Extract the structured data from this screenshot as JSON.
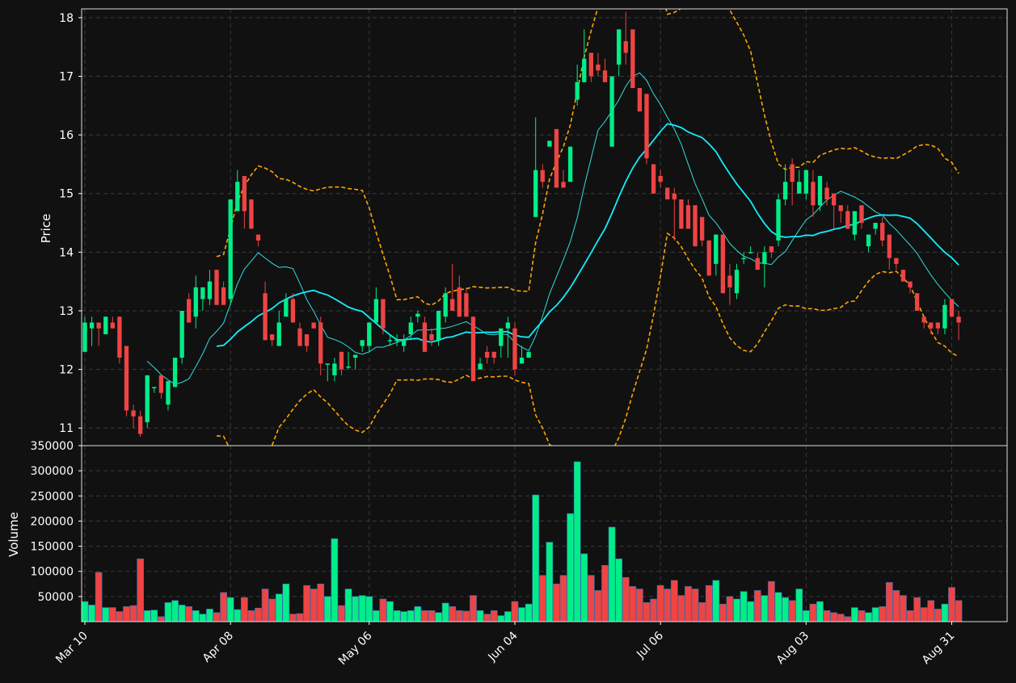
{
  "chart_data": {
    "type": "candlestick",
    "panels": [
      "price",
      "volume"
    ],
    "ylabel": "Price",
    "volume_ylabel": "Volume",
    "ylim": [
      10.7,
      18.15
    ],
    "volume_ylim": [
      0,
      350000
    ],
    "yticks": [
      11,
      12,
      13,
      14,
      15,
      16,
      17,
      18
    ],
    "volume_yticks": [
      50000,
      100000,
      150000,
      200000,
      250000,
      300000,
      350000
    ],
    "xticks": [
      {
        "label": "Mar 10",
        "index": 0
      },
      {
        "label": "Apr 08",
        "index": 21
      },
      {
        "label": "May 06",
        "index": 41
      },
      {
        "label": "Jun 04",
        "index": 62
      },
      {
        "label": "Jul 06",
        "index": 83
      },
      {
        "label": "Aug 03",
        "index": 104
      },
      {
        "label": "Aug 31",
        "index": 125
      }
    ],
    "grid": true,
    "colors": {
      "background": "#111111",
      "up": "#00ee88",
      "down": "#ee4444",
      "edge": "#3a6fb0",
      "ma_fast": "#33dddd",
      "ma_slow": "#11eeff",
      "bands": "#ffa500",
      "grid": "#3a3a3a",
      "text": "#ffffff"
    },
    "candles": [
      [
        12.3,
        12.9,
        12.3,
        12.8,
        40000
      ],
      [
        12.7,
        12.9,
        12.4,
        12.8,
        33000
      ],
      [
        12.8,
        12.8,
        12.4,
        12.7,
        98000
      ],
      [
        12.6,
        12.9,
        12.6,
        12.9,
        28000
      ],
      [
        12.8,
        12.9,
        12.7,
        12.7,
        28000
      ],
      [
        12.9,
        12.9,
        12.1,
        12.2,
        20000
      ],
      [
        12.4,
        12.4,
        11.2,
        11.3,
        30000
      ],
      [
        11.3,
        11.4,
        11.0,
        11.2,
        32000
      ],
      [
        11.2,
        11.3,
        10.85,
        10.9,
        125000
      ],
      [
        11.1,
        11.9,
        11.0,
        11.9,
        22000
      ],
      [
        11.7,
        11.7,
        11.6,
        11.7,
        23000
      ],
      [
        11.9,
        11.9,
        11.5,
        11.6,
        10000
      ],
      [
        11.4,
        11.7,
        11.3,
        11.8,
        38000
      ],
      [
        11.7,
        12.2,
        11.7,
        12.2,
        42000
      ],
      [
        12.2,
        13.0,
        12.1,
        13.0,
        33000
      ],
      [
        13.2,
        13.3,
        12.9,
        12.8,
        30000
      ],
      [
        12.9,
        13.6,
        12.7,
        13.4,
        22000
      ],
      [
        13.2,
        13.4,
        13.0,
        13.4,
        15000
      ],
      [
        13.2,
        13.7,
        13.1,
        13.5,
        25000
      ],
      [
        13.7,
        13.7,
        13.3,
        13.1,
        18000
      ],
      [
        13.4,
        13.5,
        13.2,
        13.1,
        58000
      ],
      [
        13.2,
        14.9,
        13.1,
        14.9,
        48000
      ],
      [
        14.7,
        15.4,
        14.7,
        15.2,
        24000
      ],
      [
        15.3,
        15.3,
        14.4,
        14.7,
        48000
      ],
      [
        14.9,
        14.9,
        14.4,
        14.4,
        22000
      ],
      [
        14.3,
        14.3,
        14.1,
        14.2,
        27000
      ],
      [
        13.3,
        13.5,
        12.5,
        12.5,
        65000
      ],
      [
        12.6,
        12.6,
        12.4,
        12.5,
        45000
      ],
      [
        12.4,
        13.0,
        12.4,
        12.8,
        55000
      ],
      [
        12.9,
        13.3,
        12.9,
        13.2,
        75000
      ],
      [
        13.2,
        13.3,
        12.8,
        12.8,
        15000
      ],
      [
        12.7,
        12.8,
        12.4,
        12.4,
        16000
      ],
      [
        12.6,
        12.6,
        12.3,
        12.4,
        72000
      ],
      [
        12.8,
        12.8,
        12.7,
        12.7,
        65000
      ],
      [
        12.8,
        12.9,
        11.9,
        12.1,
        75000
      ],
      [
        12.1,
        12.1,
        11.8,
        12.1,
        50000
      ],
      [
        11.9,
        12.2,
        11.8,
        12.1,
        165000
      ],
      [
        12.3,
        12.3,
        11.9,
        12.0,
        32000
      ],
      [
        12.05,
        12.3,
        12.0,
        12.05,
        65000
      ],
      [
        12.2,
        12.2,
        12.0,
        12.25,
        50000
      ],
      [
        12.4,
        12.4,
        12.3,
        12.5,
        52000
      ],
      [
        12.4,
        12.8,
        12.3,
        12.8,
        50000
      ],
      [
        12.8,
        13.4,
        12.8,
        13.2,
        22000
      ],
      [
        13.2,
        13.2,
        12.6,
        12.7,
        45000
      ],
      [
        12.5,
        12.6,
        12.4,
        12.5,
        40000
      ],
      [
        12.5,
        12.6,
        12.4,
        12.5,
        22000
      ],
      [
        12.4,
        12.6,
        12.3,
        12.5,
        20000
      ],
      [
        12.6,
        12.9,
        12.5,
        12.8,
        22000
      ],
      [
        12.9,
        13.0,
        12.8,
        12.95,
        30000
      ],
      [
        12.8,
        12.9,
        12.3,
        12.3,
        22000
      ],
      [
        12.6,
        12.7,
        12.4,
        12.5,
        22000
      ],
      [
        12.5,
        13.0,
        12.4,
        13.0,
        18000
      ],
      [
        12.9,
        13.4,
        12.8,
        13.3,
        37000
      ],
      [
        13.2,
        13.8,
        13.0,
        13.0,
        30000
      ],
      [
        13.4,
        13.6,
        12.9,
        12.9,
        22000
      ],
      [
        13.3,
        13.4,
        12.9,
        12.9,
        21000
      ],
      [
        12.9,
        12.9,
        11.8,
        11.8,
        52000
      ],
      [
        12.0,
        12.2,
        12.0,
        12.1,
        22000
      ],
      [
        12.3,
        12.4,
        12.1,
        12.2,
        15000
      ],
      [
        12.3,
        12.3,
        12.1,
        12.2,
        22000
      ],
      [
        12.4,
        12.5,
        12.2,
        12.7,
        12000
      ],
      [
        12.7,
        12.9,
        12.2,
        12.8,
        20000
      ],
      [
        12.7,
        12.8,
        11.9,
        12.0,
        40000
      ],
      [
        12.1,
        12.4,
        12.1,
        12.2,
        28000
      ],
      [
        12.2,
        12.3,
        12.2,
        12.3,
        35000
      ],
      [
        14.6,
        16.3,
        14.6,
        15.4,
        252000
      ],
      [
        15.4,
        15.5,
        15.1,
        15.2,
        92000
      ],
      [
        15.8,
        15.9,
        15.8,
        15.9,
        158000
      ],
      [
        16.1,
        16.1,
        15.1,
        15.1,
        75000
      ],
      [
        15.2,
        15.4,
        15.1,
        15.1,
        92000
      ],
      [
        15.2,
        15.8,
        15.2,
        15.8,
        215000
      ],
      [
        16.6,
        17.2,
        16.5,
        16.9,
        318000
      ],
      [
        16.9,
        17.8,
        16.9,
        17.3,
        135000
      ],
      [
        17.4,
        17.4,
        16.9,
        17.0,
        92000
      ],
      [
        17.2,
        17.4,
        17.0,
        17.1,
        62000
      ],
      [
        17.1,
        17.3,
        16.9,
        16.9,
        112000
      ],
      [
        15.8,
        17.0,
        15.8,
        17.0,
        188000
      ],
      [
        17.2,
        17.8,
        17.0,
        17.8,
        125000
      ],
      [
        17.6,
        18.1,
        17.2,
        17.4,
        88000
      ],
      [
        17.8,
        17.8,
        16.8,
        16.8,
        70000
      ],
      [
        16.8,
        16.8,
        16.4,
        16.4,
        65000
      ],
      [
        16.7,
        16.7,
        15.5,
        15.6,
        38000
      ],
      [
        15.5,
        15.5,
        15.0,
        15.0,
        45000
      ],
      [
        15.3,
        15.4,
        15.1,
        15.2,
        72000
      ],
      [
        15.1,
        15.1,
        14.9,
        14.9,
        65000
      ],
      [
        15.0,
        15.1,
        14.2,
        14.9,
        82000
      ],
      [
        14.9,
        14.9,
        14.4,
        14.4,
        52000
      ],
      [
        14.8,
        14.9,
        14.4,
        14.4,
        70000
      ],
      [
        14.8,
        14.8,
        14.1,
        14.1,
        65000
      ],
      [
        14.6,
        14.6,
        14.1,
        14.2,
        38000
      ],
      [
        14.2,
        14.2,
        13.6,
        13.6,
        72000
      ],
      [
        13.8,
        14.3,
        13.6,
        14.3,
        82000
      ],
      [
        14.3,
        14.3,
        13.3,
        13.3,
        35000
      ],
      [
        13.6,
        13.8,
        13.1,
        13.4,
        50000
      ],
      [
        13.3,
        13.8,
        13.2,
        13.7,
        45000
      ],
      [
        13.9,
        14.0,
        13.8,
        13.9,
        60000
      ],
      [
        14.0,
        14.1,
        14.0,
        14.0,
        40000
      ],
      [
        13.9,
        14.0,
        13.7,
        13.7,
        62000
      ],
      [
        13.8,
        14.1,
        13.4,
        14.0,
        52000
      ],
      [
        14.1,
        14.1,
        13.9,
        14.0,
        80000
      ],
      [
        14.2,
        15.0,
        14.1,
        14.9,
        58000
      ],
      [
        14.9,
        15.5,
        14.8,
        15.2,
        48000
      ],
      [
        15.5,
        15.6,
        14.8,
        15.2,
        42000
      ],
      [
        15.0,
        15.4,
        15.0,
        15.2,
        65000
      ],
      [
        15.0,
        15.3,
        14.9,
        15.4,
        22000
      ],
      [
        15.2,
        15.4,
        14.6,
        14.8,
        35000
      ],
      [
        14.8,
        15.3,
        14.7,
        15.3,
        40000
      ],
      [
        15.1,
        15.2,
        14.8,
        14.9,
        22000
      ],
      [
        15.0,
        15.0,
        14.4,
        14.8,
        18000
      ],
      [
        14.8,
        14.8,
        14.5,
        14.7,
        15000
      ],
      [
        14.7,
        14.8,
        14.4,
        14.4,
        10000
      ],
      [
        14.3,
        14.7,
        14.2,
        14.7,
        28000
      ],
      [
        14.8,
        14.8,
        14.4,
        14.5,
        22000
      ],
      [
        14.1,
        14.3,
        14.0,
        14.3,
        18000
      ],
      [
        14.4,
        14.5,
        14.3,
        14.5,
        28000
      ],
      [
        14.5,
        14.6,
        14.1,
        14.2,
        30000
      ],
      [
        14.3,
        14.3,
        13.7,
        13.9,
        78000
      ],
      [
        13.9,
        13.9,
        13.7,
        13.8,
        62000
      ],
      [
        13.7,
        13.7,
        13.5,
        13.5,
        52000
      ],
      [
        13.5,
        13.5,
        13.3,
        13.4,
        22000
      ],
      [
        13.3,
        13.3,
        13.0,
        13.0,
        48000
      ],
      [
        12.9,
        12.9,
        12.7,
        12.8,
        28000
      ],
      [
        12.8,
        12.8,
        12.6,
        12.7,
        42000
      ],
      [
        12.8,
        12.8,
        12.6,
        12.7,
        25000
      ],
      [
        12.7,
        13.2,
        12.6,
        13.1,
        35000
      ],
      [
        13.2,
        13.2,
        12.9,
        12.9,
        68000
      ],
      [
        12.9,
        13.0,
        12.5,
        12.8,
        42000
      ]
    ]
  }
}
